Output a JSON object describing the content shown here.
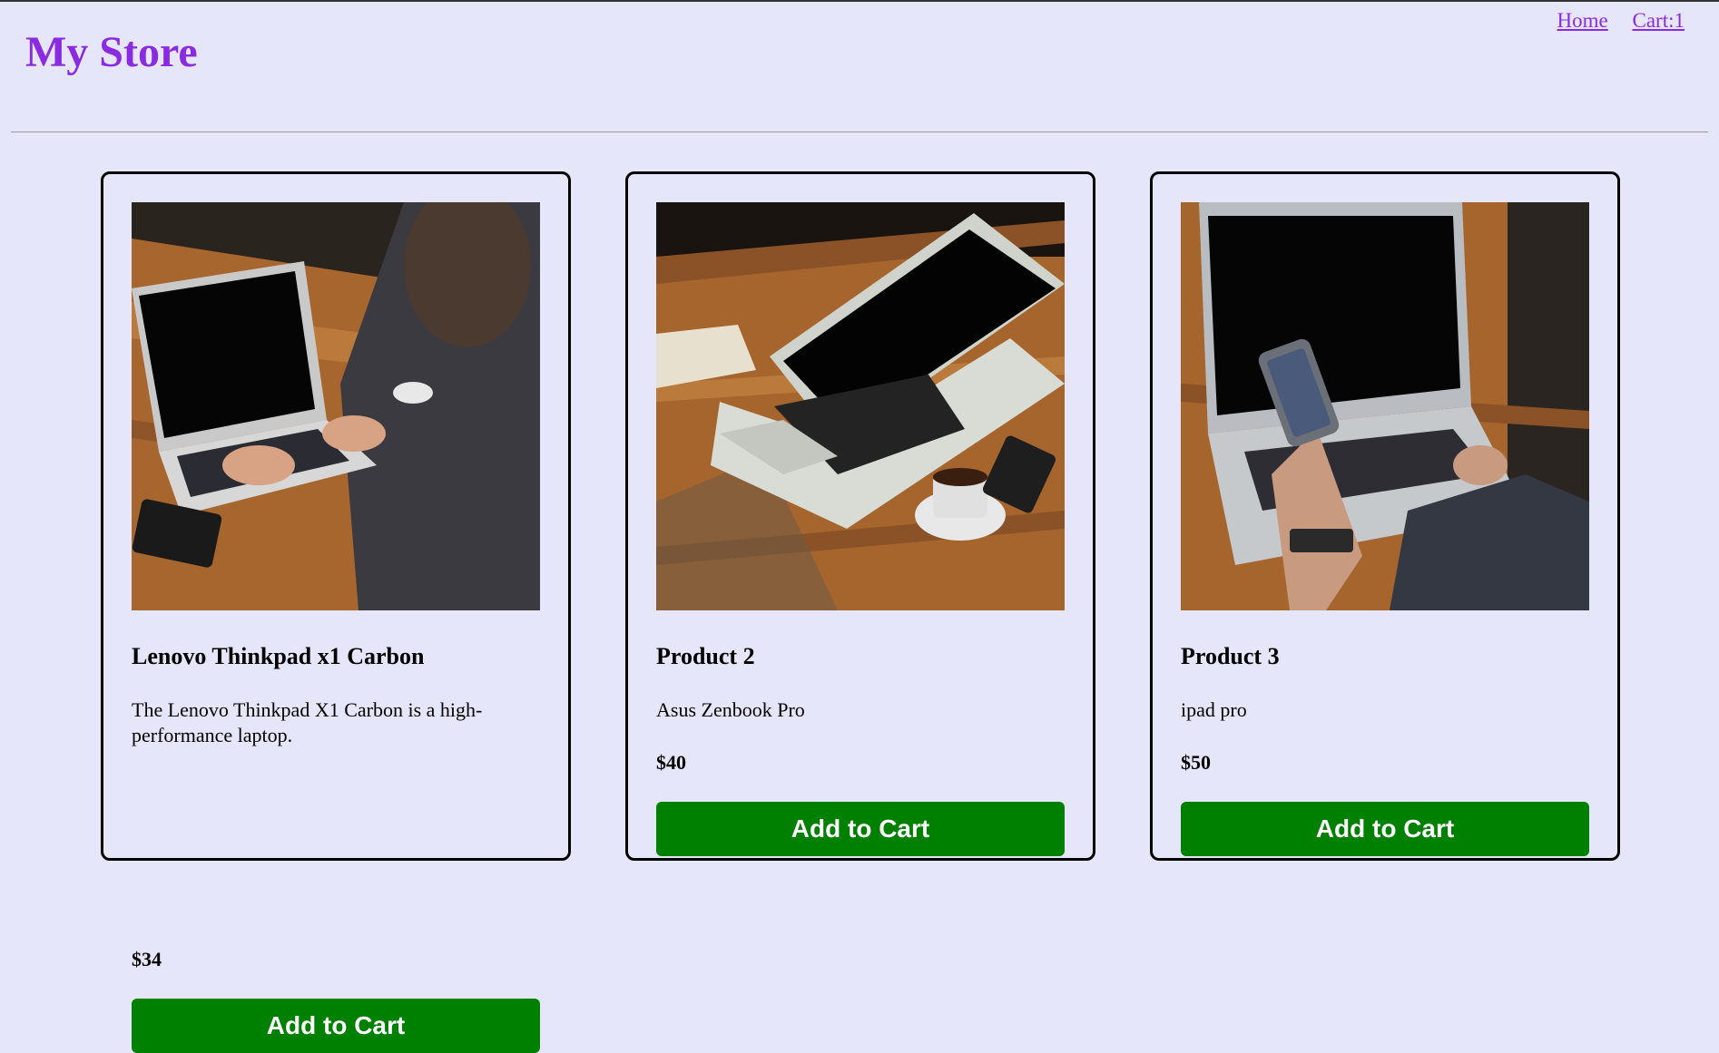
{
  "header": {
    "title": "My Store",
    "nav": {
      "home_label": "Home",
      "cart_label": "Cart:1"
    }
  },
  "products": [
    {
      "name": "Lenovo Thinkpad x1 Carbon",
      "description": "The Lenovo Thinkpad X1 Carbon is a high-performance laptop.",
      "price": "$34",
      "button_label": "Add to Cart",
      "image": "laptop-typing-photo"
    },
    {
      "name": "Product 2",
      "description": "Asus Zenbook Pro",
      "price": "$40",
      "button_label": "Add to Cart",
      "image": "laptop-with-coffee-photo"
    },
    {
      "name": "Product 3",
      "description": "ipad pro",
      "price": "$50",
      "button_label": "Add to Cart",
      "image": "laptop-and-phone-photo"
    }
  ],
  "colors": {
    "background": "#e6e6fa",
    "accent": "#8a2be2",
    "button": "#008000"
  }
}
